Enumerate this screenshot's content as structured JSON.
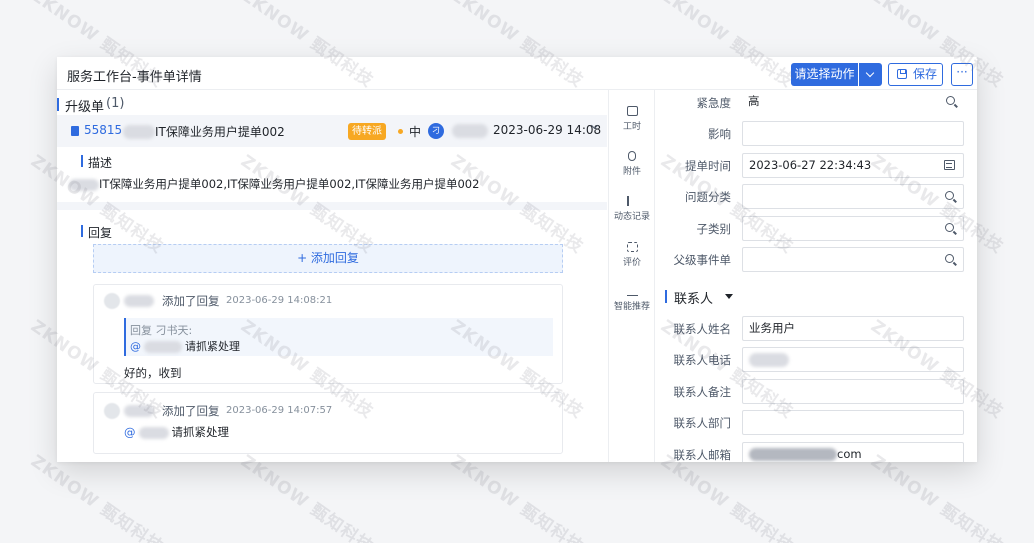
{
  "header": {
    "title": "服务工作台-事件单详情",
    "select_action": "请选择动作",
    "save": "保存",
    "more": "···"
  },
  "escalation": {
    "title": "升级单",
    "count": "(1)",
    "ticket": {
      "number": "55815",
      "title": "IT保障业务用户提单002",
      "status": "待转派",
      "priority": "中",
      "avatar_text": "刁",
      "time": "2023-06-29 14:08"
    }
  },
  "description": {
    "title": "描述",
    "text": "IT保障业务用户提单002,IT保障业务用户提单002,IT保障业务用户提单002"
  },
  "replies": {
    "title": "回复",
    "add_label": "+ 添加回复",
    "items": [
      {
        "action": "添加了回复",
        "time": "2023-06-29 14:08:21",
        "quote_header": "回复 刁书天:",
        "quote_at": "@",
        "quote_text": "请抓紧处理",
        "body": "好的，收到"
      },
      {
        "action": "添加了回复",
        "time": "2023-06-29 14:07:57",
        "at": "@",
        "body": "请抓紧处理"
      }
    ]
  },
  "rail": {
    "items": [
      {
        "label": "工时",
        "icon": "calendar-icon"
      },
      {
        "label": "附件",
        "icon": "paperclip-icon"
      },
      {
        "label": "动态记录",
        "icon": "list-icon"
      },
      {
        "label": "评价",
        "icon": "rating-icon"
      },
      {
        "label": "智能推荐",
        "icon": "recommend-icon"
      }
    ]
  },
  "form": {
    "urgency_label": "紧急度",
    "urgency_value": "高",
    "impact_label": "影响",
    "impact_value": "",
    "submit_time_label": "提单时间",
    "submit_time_value": "2023-06-27 22:34:43",
    "category_label": "问题分类",
    "category_value": "",
    "subcategory_label": "子类别",
    "subcategory_value": "",
    "parent_label": "父级事件单",
    "parent_value": "",
    "contact_section": "联系人",
    "contact_name_label": "联系人姓名",
    "contact_name_value": "业务用户",
    "contact_phone_label": "联系人电话",
    "contact_note_label": "联系人备注",
    "contact_dept_label": "联系人部门",
    "contact_email_label": "联系人邮箱",
    "contact_email_suffix": "com"
  },
  "watermark": "ZKNOW 甄知科技",
  "colors": {
    "primary": "#2f6bdf",
    "status_pending": "#f7a823"
  }
}
